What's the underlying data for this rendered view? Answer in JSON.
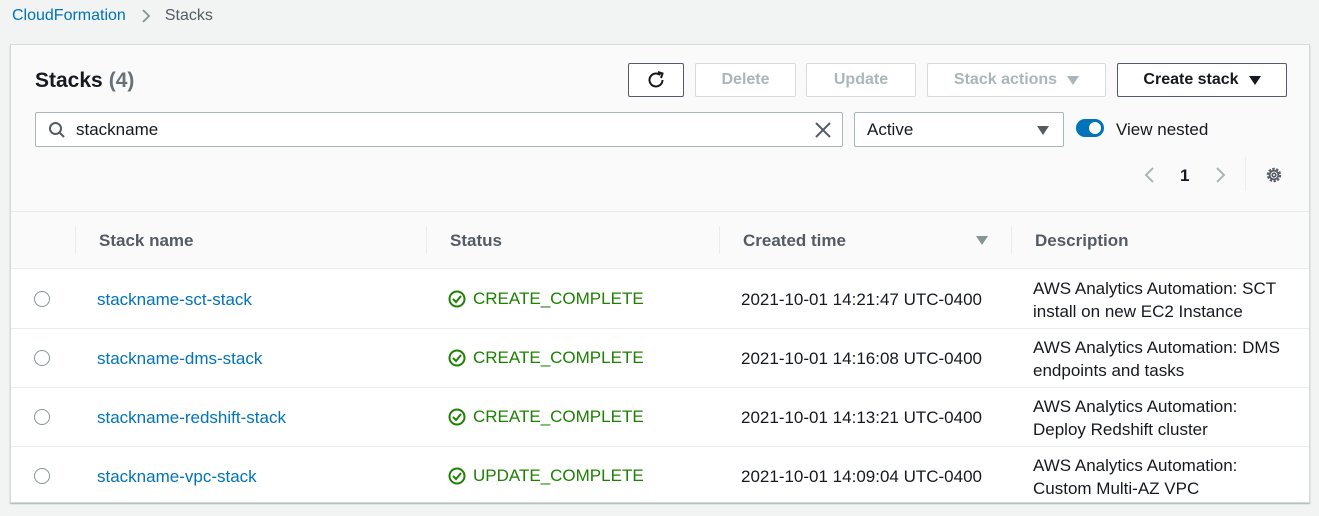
{
  "breadcrumb": {
    "root": "CloudFormation",
    "current": "Stacks"
  },
  "panel": {
    "title": "Stacks",
    "count": "(4)"
  },
  "toolbar": {
    "delete_label": "Delete",
    "update_label": "Update",
    "actions_label": "Stack actions",
    "create_label": "Create stack"
  },
  "search": {
    "value": "stackname"
  },
  "filter": {
    "selected": "Active"
  },
  "view_nested": {
    "label": "View nested",
    "enabled": true
  },
  "pagination": {
    "current_page": "1"
  },
  "table": {
    "columns": [
      "Stack name",
      "Status",
      "Created time",
      "Description"
    ],
    "rows": [
      {
        "name": "stackname-sct-stack",
        "status": "CREATE_COMPLETE",
        "created": "2021-10-01 14:21:47 UTC-0400",
        "description": "AWS Analytics Automation: SCT install on new EC2 Instance"
      },
      {
        "name": "stackname-dms-stack",
        "status": "CREATE_COMPLETE",
        "created": "2021-10-01 14:16:08 UTC-0400",
        "description": "AWS Analytics Automation: DMS endpoints and tasks"
      },
      {
        "name": "stackname-redshift-stack",
        "status": "CREATE_COMPLETE",
        "created": "2021-10-01 14:13:21 UTC-0400",
        "description": "AWS Analytics Automation: Deploy Redshift cluster"
      },
      {
        "name": "stackname-vpc-stack",
        "status": "UPDATE_COMPLETE",
        "created": "2021-10-01 14:09:04 UTC-0400",
        "description": "AWS Analytics Automation: Custom Multi-AZ VPC"
      }
    ]
  },
  "colors": {
    "link": "#0073bb",
    "success": "#1d8102",
    "disabled": "#aab7b8"
  }
}
